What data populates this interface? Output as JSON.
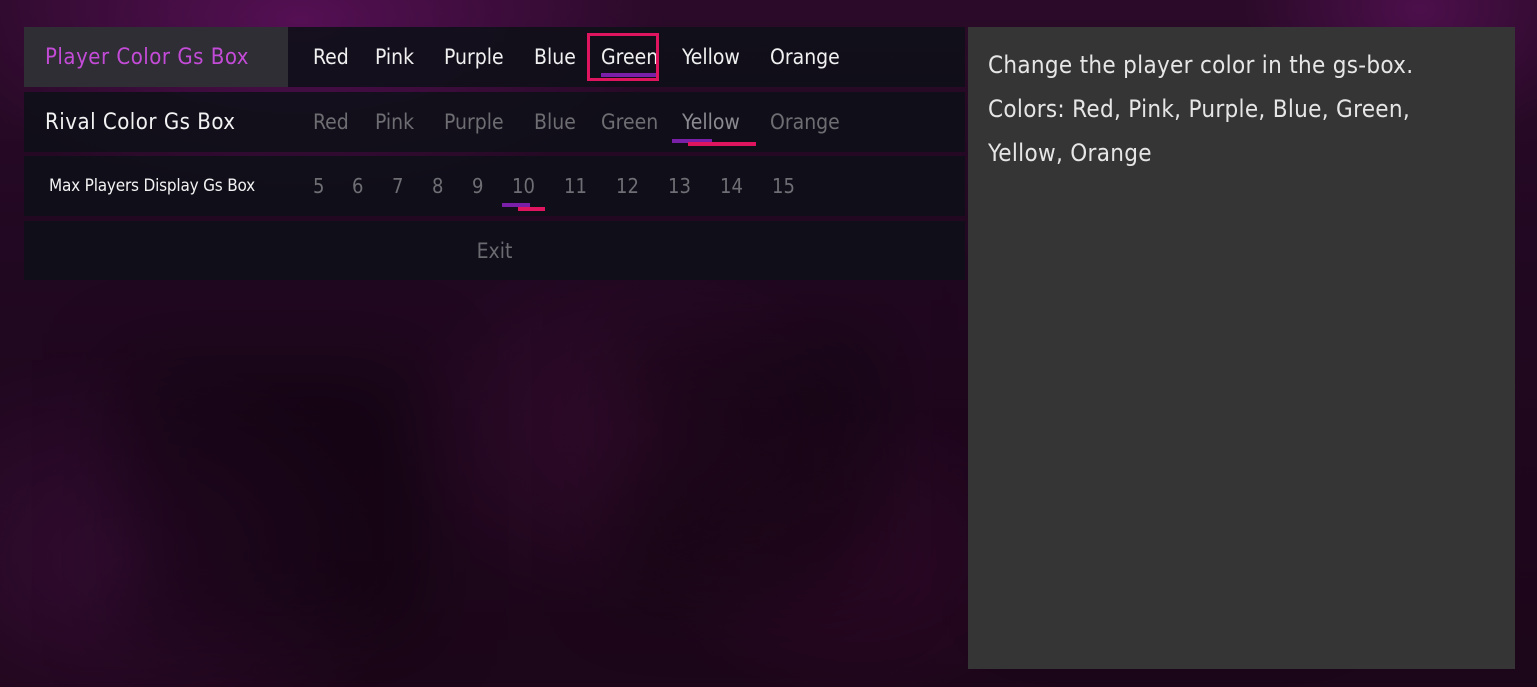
{
  "menu": {
    "rows": [
      {
        "label": "Player Color Gs Box",
        "options": [
          "Red",
          "Pink",
          "Purple",
          "Blue",
          "Green",
          "Yellow",
          "Orange"
        ],
        "selected": "Green",
        "focused": true
      },
      {
        "label": "Rival Color Gs Box",
        "options": [
          "Red",
          "Pink",
          "Purple",
          "Blue",
          "Green",
          "Yellow",
          "Orange"
        ],
        "selected": "Yellow",
        "focused": false
      },
      {
        "label": "Max Players Display Gs Box",
        "options": [
          "5",
          "6",
          "7",
          "8",
          "9",
          "10",
          "11",
          "12",
          "13",
          "14",
          "15"
        ],
        "selected": "10",
        "focused": false
      }
    ],
    "exit_label": "Exit"
  },
  "description": {
    "line1": "Change the player color in the gs-box.",
    "line2": "Colors: Red, Pink, Purple, Blue, Green,",
    "line3": "Yellow, Orange"
  },
  "colors": {
    "focus_outline": "#e0155f",
    "label_highlight": "#c44bd8",
    "underline_purple": "#7a1fa8",
    "underline_pink": "#e0155f"
  }
}
